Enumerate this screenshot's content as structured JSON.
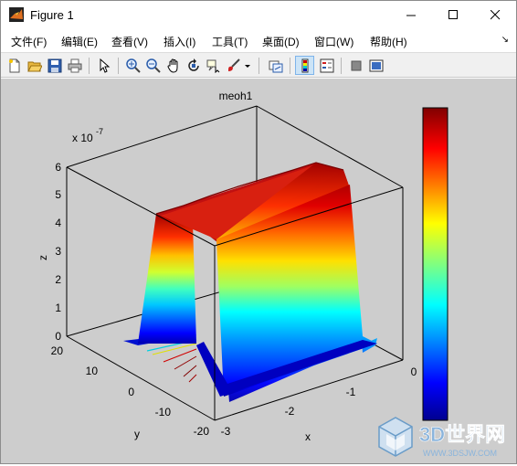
{
  "window": {
    "title": "Figure 1",
    "controls": {
      "minimize": "minimize",
      "maximize": "maximize",
      "close": "close"
    }
  },
  "menu": [
    {
      "label": "文件(F)"
    },
    {
      "label": "编辑(E)"
    },
    {
      "label": "查看(V)"
    },
    {
      "label": "插入(I)"
    },
    {
      "label": "工具(T)"
    },
    {
      "label": "桌面(D)"
    },
    {
      "label": "窗口(W)"
    },
    {
      "label": "帮助(H)"
    }
  ],
  "toolbar": {
    "buttons": [
      "new-file-icon",
      "open-folder-icon",
      "save-icon",
      "print-icon",
      "edit-plot-arrow-icon",
      "zoom-in-icon",
      "zoom-out-icon",
      "pan-hand-icon",
      "rotate-3d-icon",
      "data-cursor-icon",
      "brush-icon",
      "brush-dropdown-icon",
      "link-plot-icon",
      "colorbar-icon",
      "legend-icon",
      "hide-plot-tools-icon",
      "show-plot-tools-icon"
    ]
  },
  "plot": {
    "title": "meoh1",
    "exponent_label": "x 10",
    "exponent_power": "-7",
    "xlabel": "x",
    "ylabel": "y",
    "zlabel": "z"
  },
  "chart_data": {
    "type": "surface",
    "title": "meoh1",
    "xlabel": "x",
    "ylabel": "y",
    "zlabel": "z",
    "z_scale_label": "x 10^-7",
    "x_ticks": [
      "-3",
      "-2",
      "-1",
      "0"
    ],
    "y_ticks": [
      "20",
      "10",
      "0",
      "-10",
      "-20"
    ],
    "z_ticks": [
      "0",
      "1",
      "2",
      "3",
      "4",
      "5",
      "6"
    ],
    "xlim": [
      -3,
      0
    ],
    "ylim": [
      -20,
      20
    ],
    "zlim": [
      0,
      6
    ],
    "colormap": "jet",
    "colorbar": true,
    "surface_plateau_z": 5.0,
    "surface_plateau_y_range": [
      -20,
      5
    ]
  },
  "watermark": {
    "text": "3D世界网",
    "url": "WWW.3DSJW.COM"
  }
}
